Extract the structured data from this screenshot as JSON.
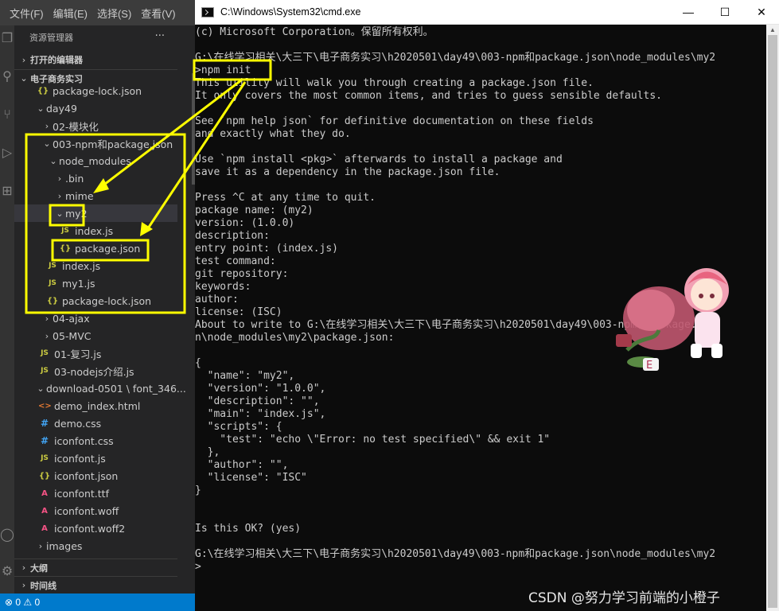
{
  "vscode": {
    "menu": [
      "文件(F)",
      "编辑(E)",
      "选择(S)",
      "查看(V)"
    ],
    "explorer_title": "资源管理器",
    "more_label": "···",
    "open_editors": "打开的编辑器",
    "workspace": "电子商务实习",
    "outline": "大纲",
    "timeline": "时间线",
    "tree": [
      {
        "label": "package-lock.json",
        "icon": "json-icon",
        "type": "file"
      },
      {
        "label": "day49",
        "type": "folder-open"
      },
      {
        "label": "02-模块化",
        "type": "folder"
      },
      {
        "label": "003-npm和package.json",
        "type": "folder-open"
      },
      {
        "label": "node_modules",
        "type": "folder-open"
      },
      {
        "label": ".bin",
        "type": "folder"
      },
      {
        "label": "mime",
        "type": "folder"
      },
      {
        "label": "my2",
        "type": "folder-open"
      },
      {
        "label": "index.js",
        "icon": "js-icon",
        "type": "file"
      },
      {
        "label": "package.json",
        "icon": "json-icon",
        "type": "file"
      },
      {
        "label": "index.js",
        "icon": "js-icon",
        "type": "file"
      },
      {
        "label": "my1.js",
        "icon": "js-icon",
        "type": "file"
      },
      {
        "label": "package-lock.json",
        "icon": "json-icon",
        "type": "file"
      },
      {
        "label": "04-ajax",
        "type": "folder"
      },
      {
        "label": "05-MVC",
        "type": "folder"
      },
      {
        "label": "01-复习.js",
        "icon": "js-icon",
        "type": "file"
      },
      {
        "label": "03-nodejs介绍.js",
        "icon": "js-icon",
        "type": "file"
      },
      {
        "label": "download-0501 \\ font_346...",
        "type": "folder-open"
      },
      {
        "label": "demo_index.html",
        "icon": "html-icon",
        "type": "file"
      },
      {
        "label": "demo.css",
        "icon": "css-icon",
        "type": "file"
      },
      {
        "label": "iconfont.css",
        "icon": "css-icon",
        "type": "file"
      },
      {
        "label": "iconfont.js",
        "icon": "js-icon",
        "type": "file"
      },
      {
        "label": "iconfont.json",
        "icon": "json-icon",
        "type": "file"
      },
      {
        "label": "iconfont.ttf",
        "icon": "font-icon",
        "type": "file"
      },
      {
        "label": "iconfont.woff",
        "icon": "font-icon",
        "type": "file"
      },
      {
        "label": "iconfont.woff2",
        "icon": "font-icon",
        "type": "file"
      },
      {
        "label": "images",
        "type": "folder"
      }
    ],
    "status": "⊗ 0 ⚠ 0",
    "accent_color": "#007acc"
  },
  "cmd": {
    "title": "C:\\Windows\\System32\\cmd.exe",
    "buttons": {
      "minimize": "—",
      "maximize": "☐",
      "close": "✕"
    },
    "lines": [
      "(c) Microsoft Corporation。保留所有权利。",
      "",
      "G:\\在线学习相关\\大三下\\电子商务实习\\h2020501\\day49\\003-npm和package.json\\node_modules\\my2",
      ">npm init",
      "This utility will walk you through creating a package.json file.",
      "It only covers the most common items, and tries to guess sensible defaults.",
      "",
      "See `npm help json` for definitive documentation on these fields",
      "and exactly what they do.",
      "",
      "Use `npm install <pkg>` afterwards to install a package and",
      "save it as a dependency in the package.json file.",
      "",
      "Press ^C at any time to quit.",
      "package name: (my2)",
      "version: (1.0.0)",
      "description:",
      "entry point: (index.js)",
      "test command:",
      "git repository:",
      "keywords:",
      "author:",
      "license: (ISC)",
      "About to write to G:\\在线学习相关\\大三下\\电子商务实习\\h2020501\\day49\\003-npm和package.jso",
      "n\\node_modules\\my2\\package.json:",
      "",
      "{",
      "  \"name\": \"my2\",",
      "  \"version\": \"1.0.0\",",
      "  \"description\": \"\",",
      "  \"main\": \"index.js\",",
      "  \"scripts\": {",
      "    \"test\": \"echo \\\"Error: no test specified\\\" && exit 1\"",
      "  },",
      "  \"author\": \"\",",
      "  \"license\": \"ISC\"",
      "}",
      "",
      "",
      "Is this OK? (yes)",
      "",
      "G:\\在线学习相关\\大三下\\电子商务实习\\h2020501\\day49\\003-npm和package.json\\node_modules\\my2",
      ">"
    ],
    "bg_color": "#0c0c0c",
    "fg_color": "#cccccc"
  },
  "watermark": "CSDN @努力学习前端的小橙子",
  "annotation_color": "#ffff00"
}
